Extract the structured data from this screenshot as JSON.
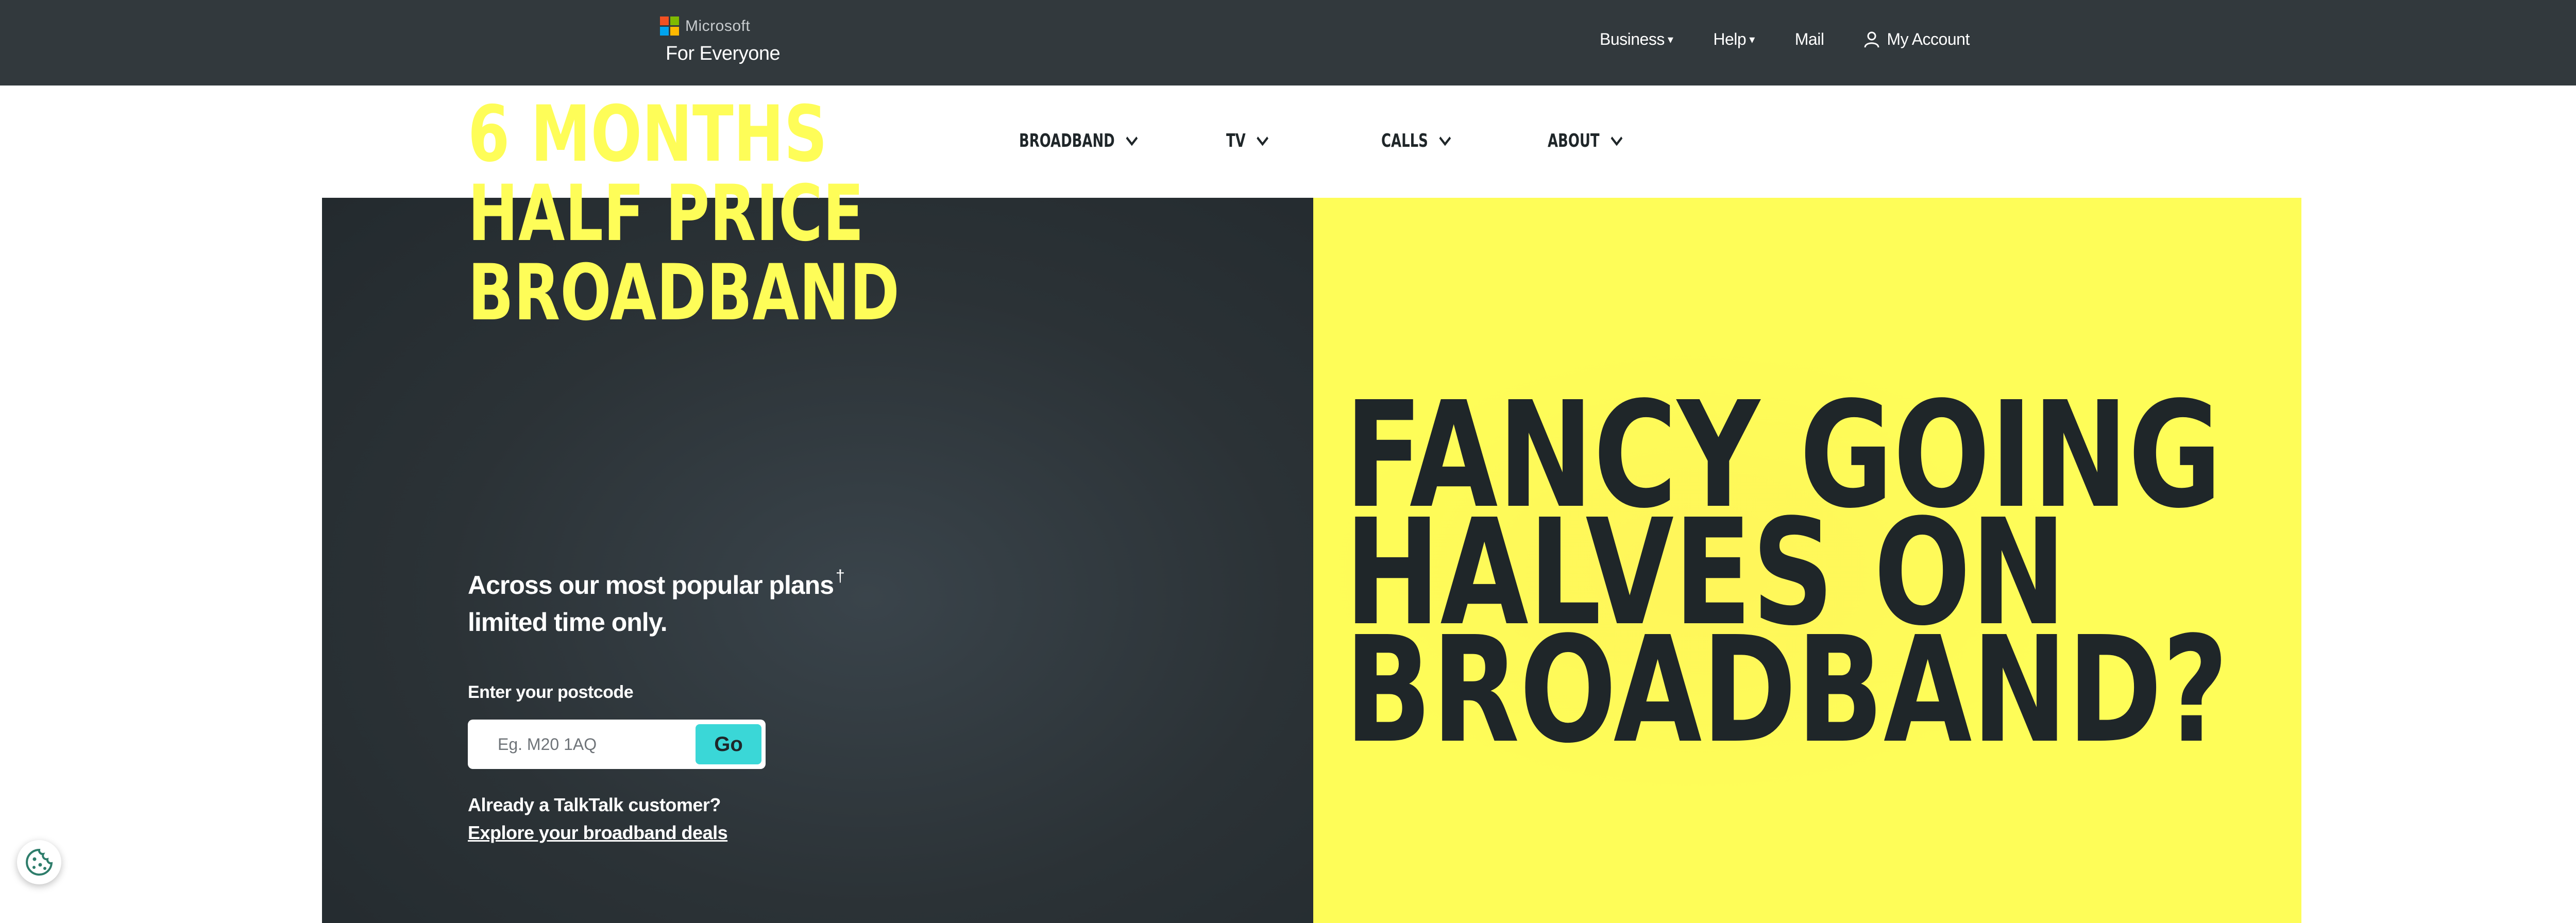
{
  "header": {
    "logo_text": "Microsoft",
    "logo_colors": [
      "#f25022",
      "#7fba00",
      "#00a4ef",
      "#ffb900"
    ],
    "tagline": "For Everyone",
    "links": [
      {
        "label": "Business",
        "arrow": "▾"
      },
      {
        "label": "Help",
        "arrow": "▾"
      },
      {
        "label": "Mail"
      }
    ],
    "account_label": "My Account",
    "account_icon": "user-icon"
  },
  "main_nav": {
    "items": [
      {
        "label": "BROADBAND",
        "icon": "chevron-down-icon"
      },
      {
        "label": "TV",
        "icon": "chevron-down-icon"
      },
      {
        "label": "CALLS",
        "icon": "chevron-down-icon"
      },
      {
        "label": "ABOUT",
        "icon": "chevron-down-icon"
      }
    ]
  },
  "hero": {
    "headline": [
      "6 MONTHS",
      "HALF PRICE",
      "BROADBAND"
    ],
    "subcopy_line1": "Across our most popular plans",
    "subcopy_dagger": "†",
    "subcopy_line2": "limited time only.",
    "postcode_label": "Enter your postcode",
    "postcode_placeholder": "Eg. M20 1AQ",
    "go_label": "Go",
    "already_customer": "Already a TalkTalk customer?",
    "explore_link": "Explore your broadband deals",
    "panel_text": [
      "FANCY GOING",
      "HALVES ON",
      "BROADBAND?"
    ]
  },
  "colors": {
    "header_bg": "#32393d",
    "accent_yellow": "#fefd58",
    "go_button": "#3ad7d7",
    "dark_text": "#1f2629"
  },
  "cookie_button_icon": "cookie-icon"
}
